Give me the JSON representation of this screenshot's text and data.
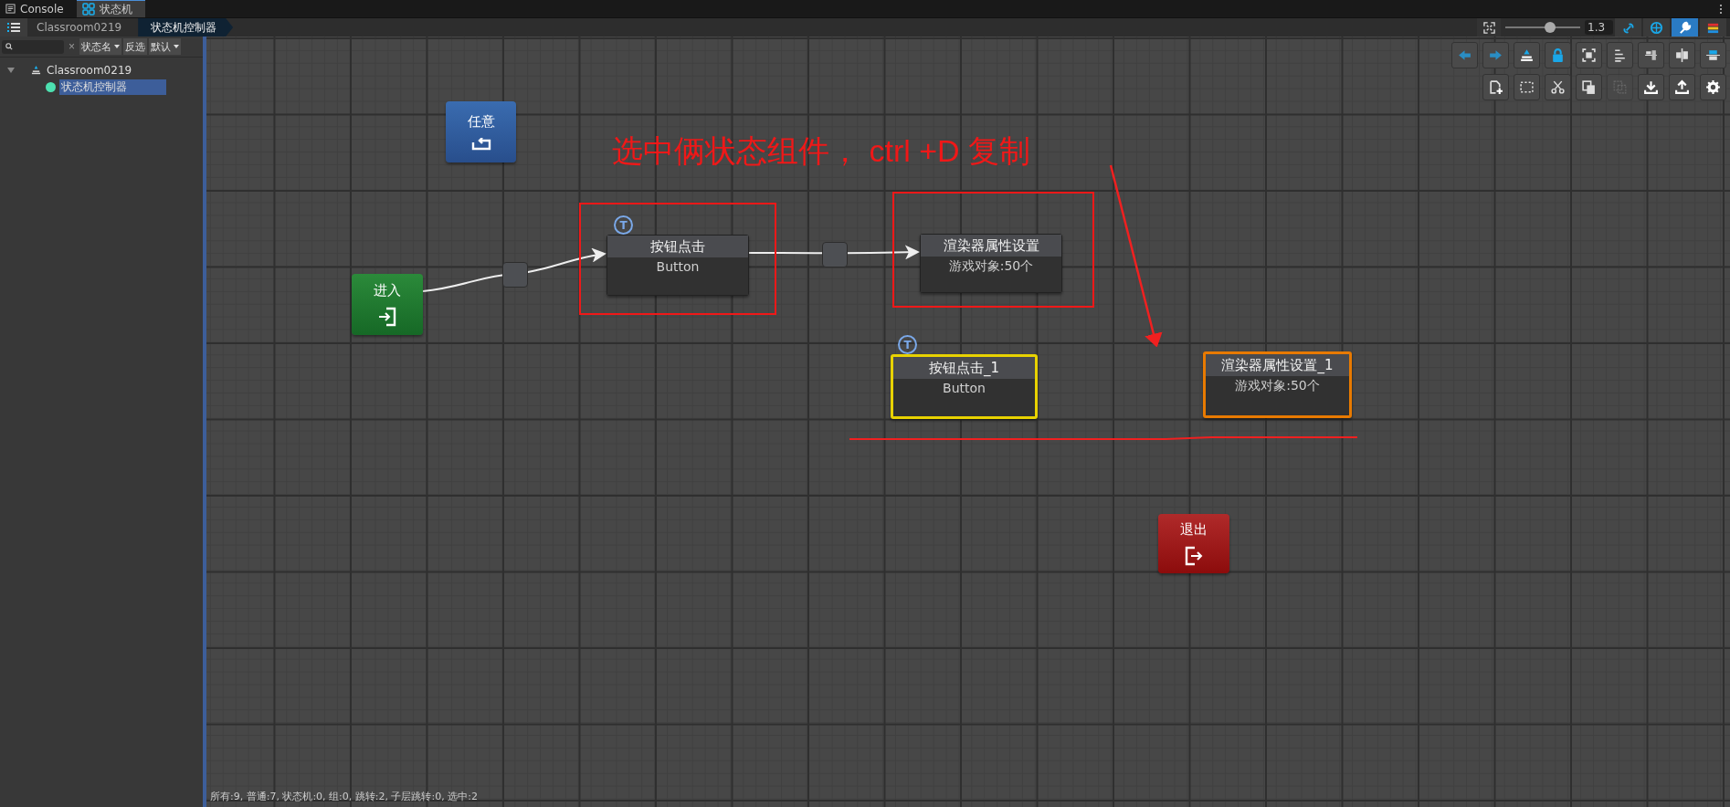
{
  "tabs": [
    {
      "label": "Console",
      "selected": false
    },
    {
      "label": "状态机",
      "selected": true
    }
  ],
  "breadcrumb": [
    "Classroom0219",
    "状态机控制器"
  ],
  "zoom": {
    "level": 0.6,
    "value": "1.3"
  },
  "view_tools": [
    {
      "selected": false
    },
    {
      "selected": false
    },
    {
      "selected": true
    },
    {
      "selected": false
    }
  ],
  "edit_tools": [
    {
      "disabled": false
    },
    {
      "disabled": false
    },
    {
      "disabled": false
    },
    {
      "disabled": false
    },
    {
      "disabled": true
    },
    {
      "disabled": false
    },
    {
      "disabled": false
    },
    {
      "disabled": false
    }
  ],
  "sidebar": {
    "clear": "×",
    "filter": "状态名",
    "invert": "反选",
    "sort": "默认",
    "tree": [
      {
        "label": "Classroom0219",
        "expanded": true,
        "selected": false,
        "children": [
          {
            "label": "状态机控制器",
            "selected": true
          }
        ]
      }
    ]
  },
  "nodes": [
    {
      "kind": "any",
      "title": "任意"
    },
    {
      "kind": "entry",
      "title": "进入"
    },
    {
      "kind": "state",
      "title": "按钮点击",
      "subtitle": "Button",
      "badge": "T",
      "selected": false
    },
    {
      "kind": "state",
      "title": "渲染器属性设置",
      "subtitle": "游戏对象:50个",
      "selected": false
    },
    {
      "kind": "state",
      "title": "按钮点击_1",
      "subtitle": "Button",
      "badge": "T",
      "selected": true,
      "color": "#e8d200"
    },
    {
      "kind": "state",
      "title": "渲染器属性设置_1",
      "subtitle": "游戏对象:50个",
      "selected": true,
      "color": "#e87a00"
    },
    {
      "kind": "exit",
      "title": "退出"
    }
  ],
  "annotation": {
    "text": "选中俩状态组件， ctrl +D  复制"
  },
  "status_bar": "所有:9, 普通:7, 状态机:0, 组:0, 跳转:2, 子层跳转:0, 选中:2"
}
